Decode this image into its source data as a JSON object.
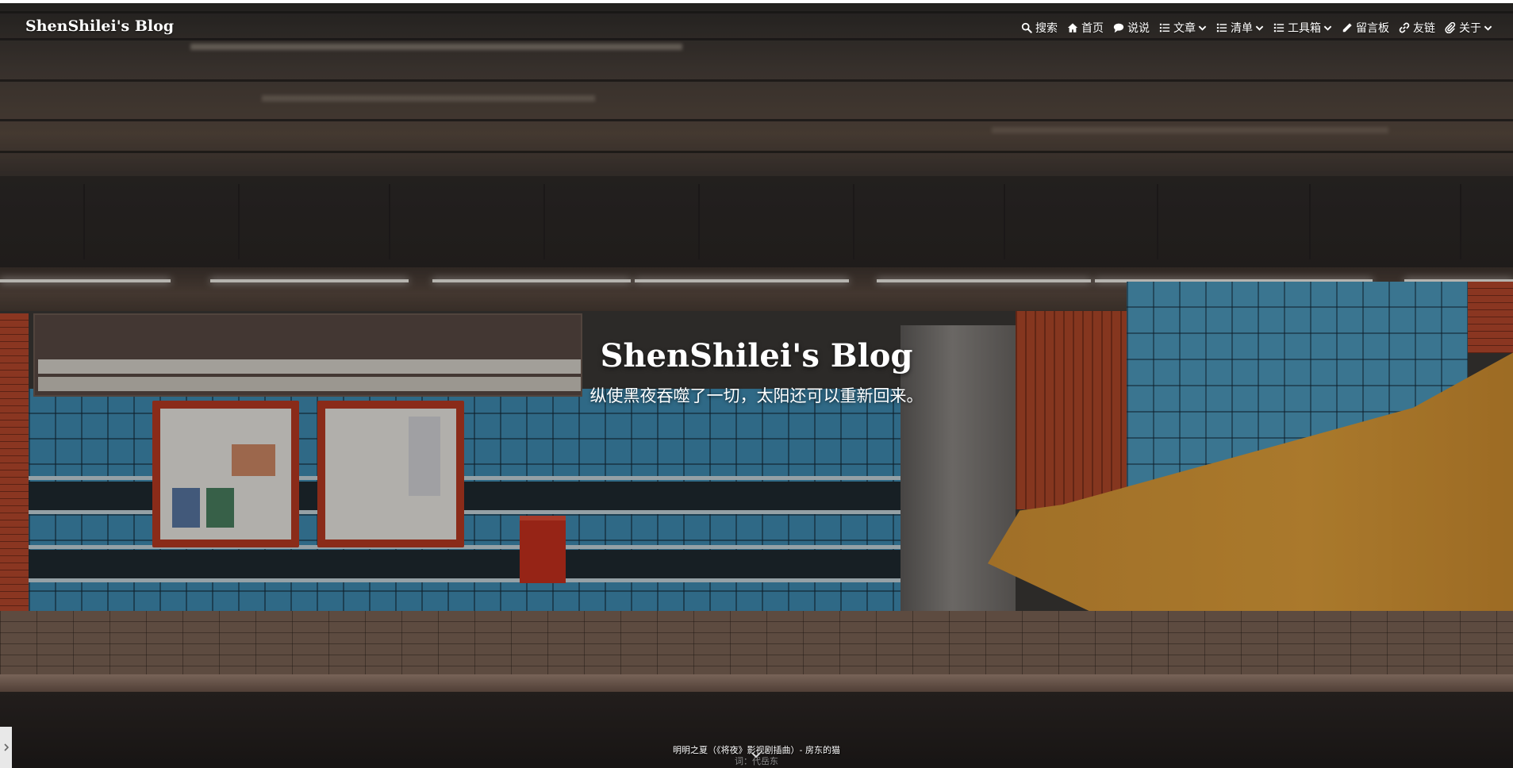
{
  "site": {
    "brand": "ShenShilei's Blog"
  },
  "nav": {
    "items": [
      {
        "label": "搜索",
        "icon": "search-icon",
        "has_dropdown": false
      },
      {
        "label": "首页",
        "icon": "home-icon",
        "has_dropdown": false
      },
      {
        "label": "说说",
        "icon": "comment-icon",
        "has_dropdown": false
      },
      {
        "label": "文章",
        "icon": "list-icon",
        "has_dropdown": true
      },
      {
        "label": "清单",
        "icon": "list-icon",
        "has_dropdown": true
      },
      {
        "label": "工具箱",
        "icon": "list-icon",
        "has_dropdown": true
      },
      {
        "label": "留言板",
        "icon": "pencil-icon",
        "has_dropdown": false
      },
      {
        "label": "友链",
        "icon": "link-icon",
        "has_dropdown": false
      },
      {
        "label": "关于",
        "icon": "paperclip-icon",
        "has_dropdown": true
      }
    ]
  },
  "hero": {
    "title": "ShenShilei's Blog",
    "subtitle": "纵使黑夜吞噬了一切，太阳还可以重新回来。"
  },
  "player": {
    "song_line": "明明之夏（《将夜》影视剧插曲）- 房东的猫",
    "lyric_line": "词：代岳东"
  },
  "colors": {
    "nav_text": "#ffffff",
    "hero_text": "#ffffff"
  }
}
